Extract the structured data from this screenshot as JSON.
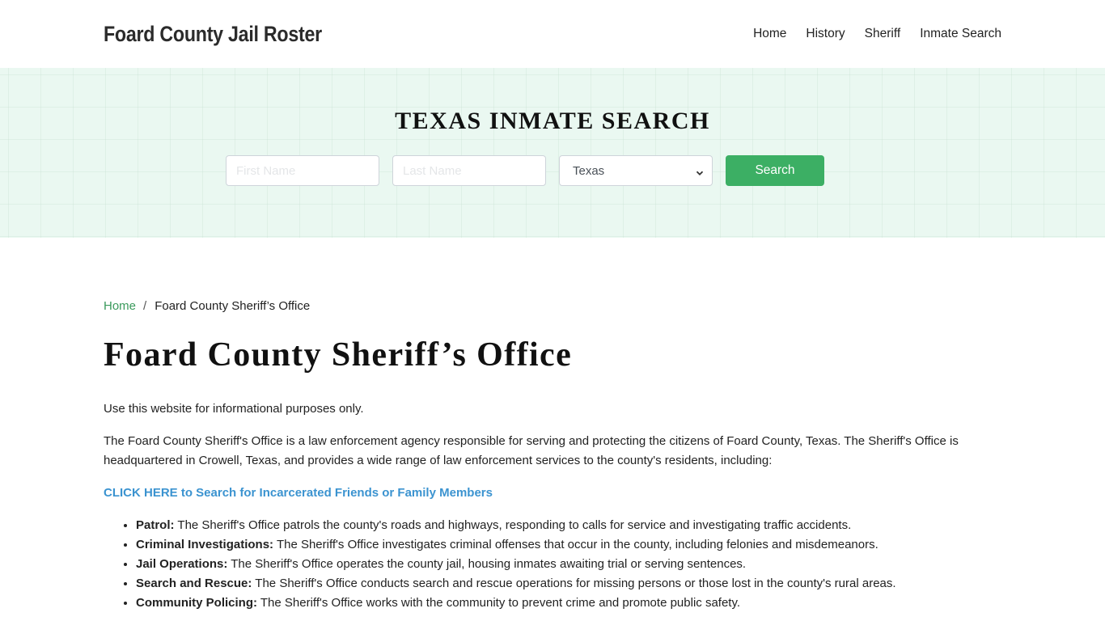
{
  "header": {
    "brand": "Foard County Jail Roster",
    "nav": [
      {
        "label": "Home"
      },
      {
        "label": "History"
      },
      {
        "label": "Sheriff"
      },
      {
        "label": "Inmate Search"
      }
    ]
  },
  "banner": {
    "title": "TEXAS INMATE SEARCH",
    "first_name_placeholder": "First Name",
    "first_name_value": "",
    "last_name_placeholder": "Last Name",
    "last_name_value": "",
    "state_selected": "Texas",
    "search_label": "Search",
    "background_color": "#eaf8f1",
    "button_color": "#3caf64"
  },
  "breadcrumb": {
    "home": "Home",
    "separator": "/",
    "current": "Foard County Sheriff’s Office"
  },
  "page": {
    "title": "Foard County Sheriff’s Office",
    "disclaimer": "Use this website for informational purposes only.",
    "intro": "The Foard County Sheriff's Office is a law enforcement agency responsible for serving and protecting the citizens of Foard County, Texas. The Sheriff's Office is headquartered in Crowell, Texas, and provides a wide range of law enforcement services to the county's residents, including:",
    "cta_link": "CLICK HERE to Search for Incarcerated Friends or Family Members",
    "services": [
      {
        "term": "Patrol:",
        "text": " The Sheriff's Office patrols the county's roads and highways, responding to calls for service and investigating traffic accidents."
      },
      {
        "term": "Criminal Investigations:",
        "text": " The Sheriff's Office investigates criminal offenses that occur in the county, including felonies and misdemeanors."
      },
      {
        "term": "Jail Operations:",
        "text": " The Sheriff's Office operates the county jail, housing inmates awaiting trial or serving sentences."
      },
      {
        "term": "Search and Rescue:",
        "text": " The Sheriff's Office conducts search and rescue operations for missing persons or those lost in the county's rural areas."
      },
      {
        "term": "Community Policing:",
        "text": " The Sheriff's Office works with the community to prevent crime and promote public safety."
      }
    ]
  },
  "colors": {
    "link_green": "#3a9a5c",
    "cta_blue": "#3b93d0"
  }
}
